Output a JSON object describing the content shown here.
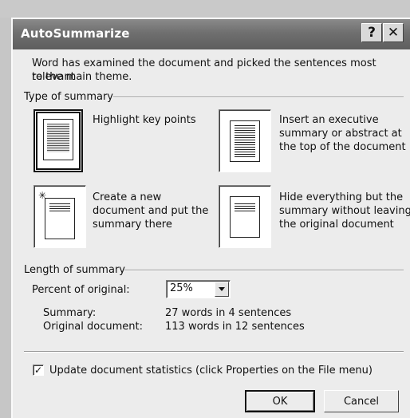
{
  "window": {
    "title": "AutoSummarize",
    "help_glyph": "?",
    "close_glyph": "✕"
  },
  "intro": {
    "line1": "Word has examined the document and picked the sentences most relevant",
    "line2": "to the main theme."
  },
  "type_of_summary": {
    "label": "Type of summary",
    "options": [
      {
        "lines": [
          "Highlight key points"
        ],
        "selected": true
      },
      {
        "lines": [
          "Insert an executive",
          "summary or abstract at",
          "the top of the document"
        ],
        "selected": false
      },
      {
        "lines": [
          "Create a new",
          "document and put the",
          "summary there"
        ],
        "selected": false
      },
      {
        "lines": [
          "Hide everything but the",
          "summary without leaving",
          "the original document"
        ],
        "selected": false
      }
    ]
  },
  "length": {
    "label": "Length of summary",
    "percent_label": "Percent of original:",
    "percent_value": "25%",
    "summary_label": "Summary:",
    "summary_value": "27 words in 4 sentences",
    "original_label": "Original document:",
    "original_value": "113 words in 12 sentences"
  },
  "update_stats": {
    "checked": true,
    "label": "Update document statistics (click Properties on the File menu)"
  },
  "buttons": {
    "ok": "OK",
    "cancel": "Cancel"
  }
}
